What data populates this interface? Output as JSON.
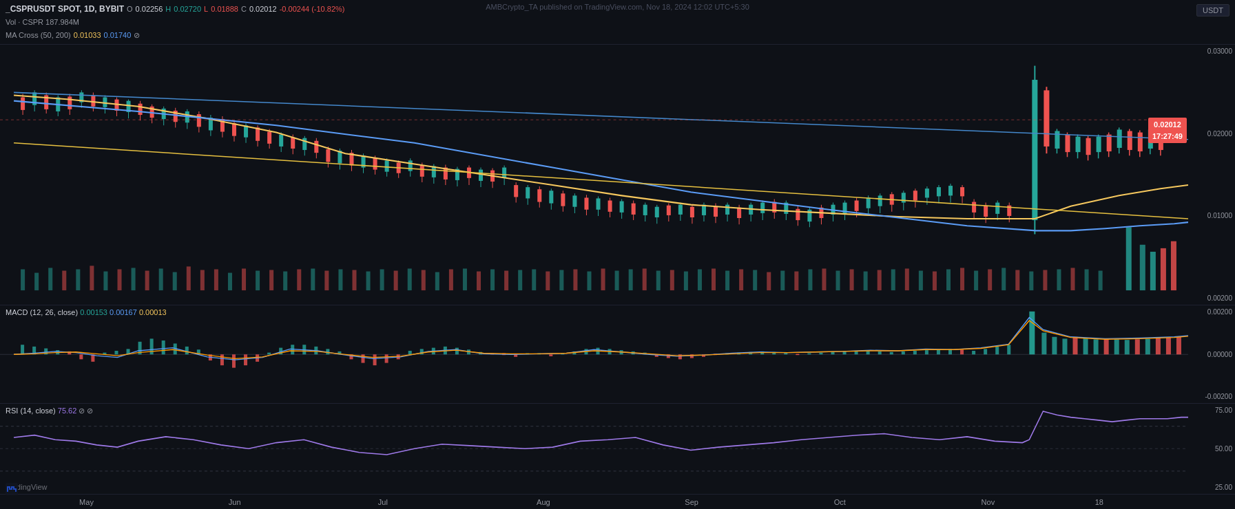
{
  "attribution": "AMBCrypto_TA published on TradingView.com, Nov 18, 2024 12:02 UTC+5:30",
  "header": {
    "symbol": "_CSPRUSDT SPOT, 1D, BYBIT",
    "open_label": "O",
    "open_val": "0.02256",
    "high_label": "H",
    "high_val": "0.02720",
    "low_label": "L",
    "low_val": "0.01888",
    "close_label": "C",
    "close_val": "0.02012",
    "change": "-0.00244 (-10.82%)",
    "vol": "Vol · CSPR  187.984M",
    "ma_cross_label": "MA Cross (50, 200)",
    "ma_val1": "0.01033",
    "ma_val2": "0.01740",
    "usdt": "USDT"
  },
  "price_badge": {
    "price": "0.02012",
    "time": "17:27:49",
    "top_pct": "28"
  },
  "macd": {
    "label": "MACD (12, 26, close)",
    "val1": "0.00153",
    "val2": "0.00167",
    "val3": "0.00013"
  },
  "rsi": {
    "label": "RSI (14, close)",
    "val": "75.62"
  },
  "y_axis_main": [
    "0.03000",
    "0.02000",
    "0.01000",
    "0.00200"
  ],
  "y_axis_macd": [
    "0.00200",
    "0.00000",
    "-0.00200"
  ],
  "y_axis_rsi": [
    "75.00",
    "50.00",
    "25.00"
  ],
  "x_axis": [
    "May",
    "Jun",
    "Jul",
    "Aug",
    "Sep",
    "Oct",
    "Nov",
    "18"
  ],
  "x_positions": [
    7,
    17,
    28,
    39,
    51,
    62,
    74,
    86
  ]
}
